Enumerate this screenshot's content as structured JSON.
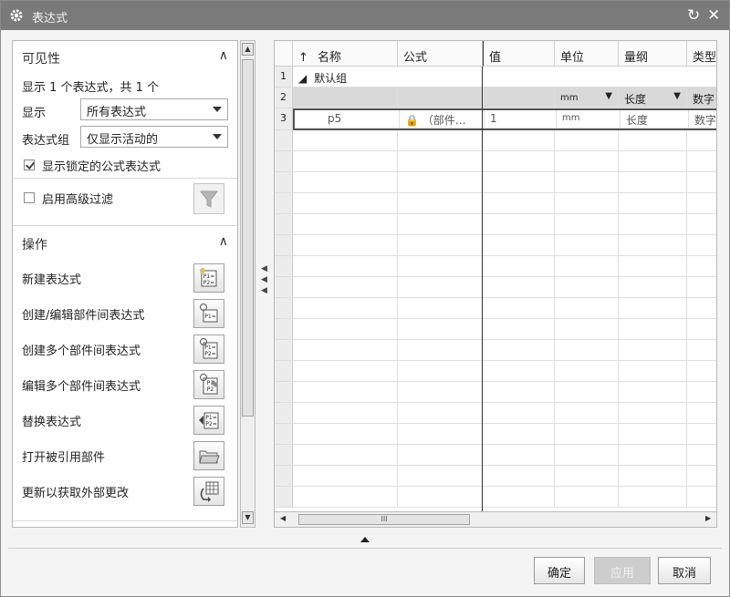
{
  "window": {
    "title": "表达式",
    "reset_icon": "reset-icon",
    "close_icon": "close-icon"
  },
  "visibility": {
    "header": "可见性",
    "summary": "显示 1 个表达式，共 1 个",
    "show_label": "显示",
    "show_value": "所有表达式",
    "group_label": "表达式组",
    "group_value": "仅显示活动的",
    "locked_checkbox_label": "显示锁定的公式表达式",
    "locked_checked": true,
    "advanced_filter_label": "启用高级过滤",
    "advanced_filter_checked": false
  },
  "operations": {
    "header": "操作",
    "items": [
      {
        "label": "新建表达式",
        "icon": "new-expression-icon"
      },
      {
        "label": "创建/编辑部件间表达式",
        "icon": "interpart-expression-icon"
      },
      {
        "label": "创建多个部件间表达式",
        "icon": "multi-interpart-create-icon"
      },
      {
        "label": "编辑多个部件间表达式",
        "icon": "multi-interpart-edit-icon"
      },
      {
        "label": "替换表达式",
        "icon": "replace-expression-icon"
      },
      {
        "label": "打开被引用部件",
        "icon": "open-folder-icon"
      },
      {
        "label": "更新以获取外部更改",
        "icon": "update-external-icon"
      }
    ]
  },
  "grid": {
    "columns": [
      "名称",
      "公式",
      "值",
      "单位",
      "量纲",
      "类型"
    ],
    "sort_indicator": "↑",
    "row_numbers": [
      "1",
      "2",
      "3"
    ],
    "group_row": {
      "label": "默认组"
    },
    "filter_row": {
      "unit": "mm",
      "dimension": "长度",
      "type": "数字"
    },
    "data_rows": [
      {
        "name": "p5",
        "formula": "（部件…",
        "value": "1",
        "unit": "mm",
        "dimension": "长度",
        "type": "数字"
      }
    ]
  },
  "footer": {
    "ok": "确定",
    "apply": "应用",
    "cancel": "取消"
  }
}
